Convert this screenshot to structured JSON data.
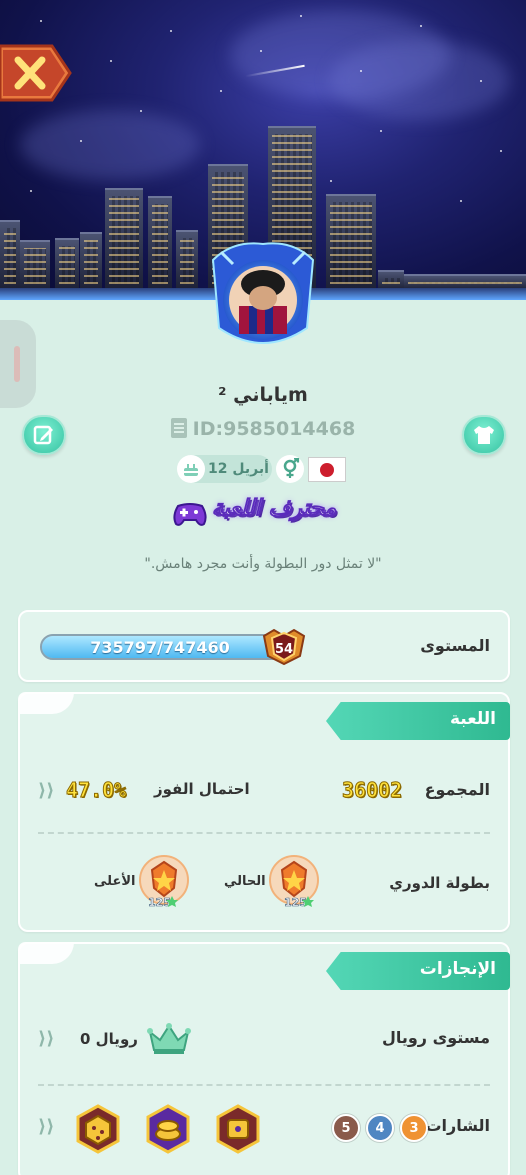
{
  "profile": {
    "username": "ياباني ²m",
    "id_text": "ID:9585014468",
    "birthday": "12 أبريل",
    "title": "محترف اللعبة",
    "quote": "\"لا تمثل دور البطولة وأنت مجرد هامش.\""
  },
  "icons": {
    "close": "close-icon",
    "edit": "edit-icon",
    "shirt": "shirt-icon",
    "cake": "cake-icon",
    "gender": "gender-icon",
    "flag": "japan-flag-icon",
    "gamepad": "gamepad-icon"
  },
  "level": {
    "label": "المستوى",
    "xp_text": "735797/747460",
    "xp_fraction": 0.984,
    "level_number": "54"
  },
  "game": {
    "header": "اللعبة",
    "total_label": "المجموع",
    "total_value": "36002",
    "winrate_label": "احتمال الفوز",
    "winrate_value": "47.0%",
    "league_label": "بطولة الدوري",
    "current_label": "الحالي",
    "highest_label": "الأعلى",
    "current_rank": "125",
    "highest_rank": "125"
  },
  "achievements": {
    "header": "الإنجازات",
    "royal_label": "مستوى رويال",
    "royal_value": "رويال 0",
    "badges_label": "الشارات",
    "badge_counts": [
      "3",
      "4",
      "5"
    ]
  },
  "colors": {
    "background": "#d9f0e7",
    "accent": "#36c3a2",
    "gold": "#ffe23c",
    "xp": "#4fb9f1"
  }
}
